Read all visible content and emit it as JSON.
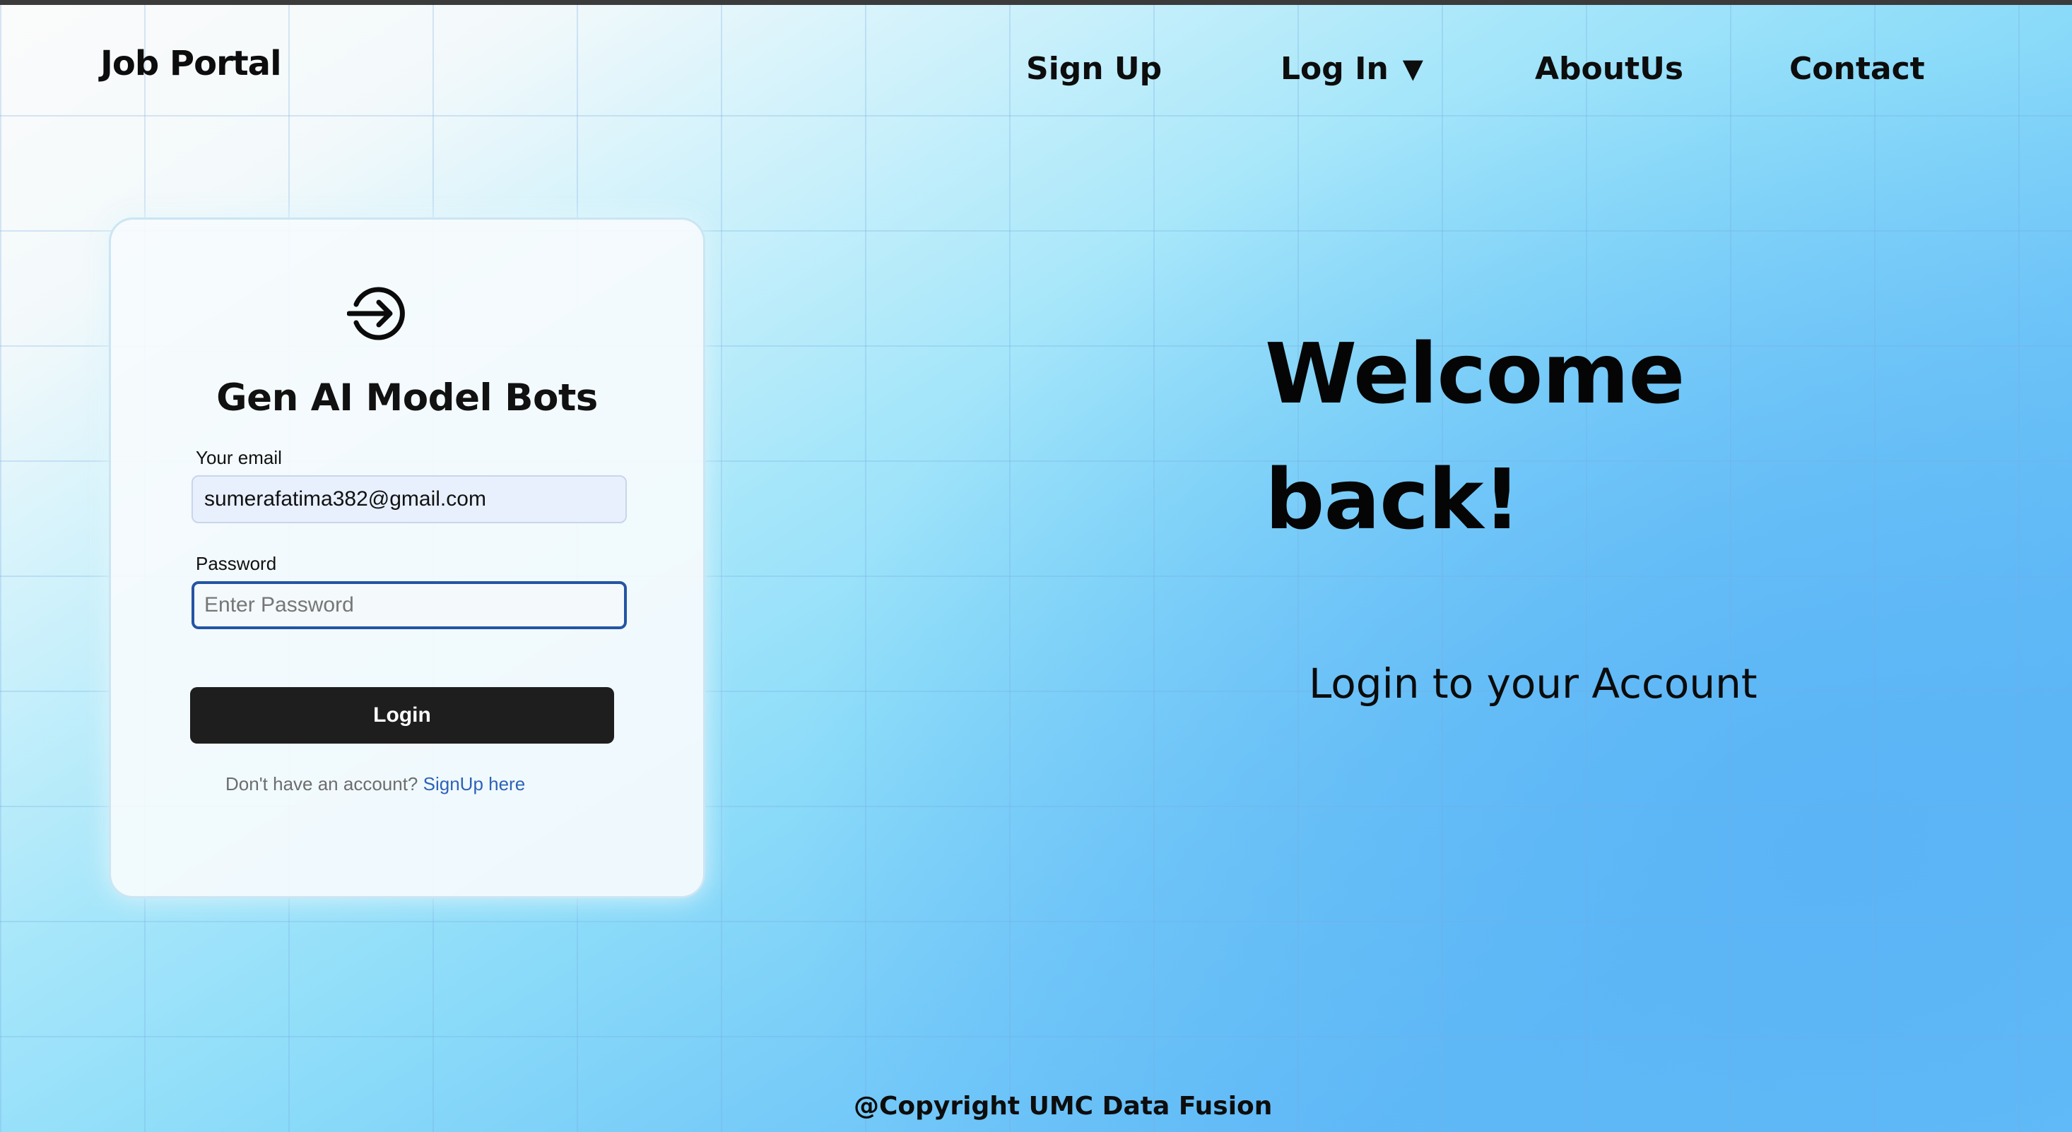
{
  "header": {
    "brand": "Job Portal",
    "nav": {
      "signup": "Sign Up",
      "login": "Log In",
      "login_caret": "▼",
      "about": "AboutUs",
      "contact": "Contact"
    }
  },
  "login_card": {
    "icon": "login-arrow-circle-icon",
    "title": "Gen AI Model Bots",
    "email_label": "Your email",
    "email_value": "sumerafatima382@gmail.com",
    "password_label": "Password",
    "password_placeholder": "Enter Password",
    "login_button": "Login",
    "signup_prompt": "Don't have an account?",
    "signup_link": "SignUp here"
  },
  "hero": {
    "welcome_line1": "Welcome",
    "welcome_line2": "back!",
    "subtitle": "Login to your Account"
  },
  "footer": {
    "copyright": "@Copyright UMC Data Fusion"
  },
  "colors": {
    "button_bg": "#1e1e1e",
    "link": "#2e62b8",
    "focus_border": "#2455a4",
    "autofill_bg": "#e8f0fe"
  }
}
